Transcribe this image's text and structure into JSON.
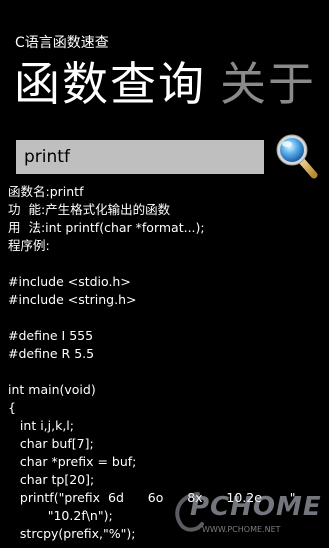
{
  "app": {
    "title": "C语言函数速查"
  },
  "pivot": {
    "items": [
      {
        "label": "函数查询"
      },
      {
        "label": "关于"
      }
    ]
  },
  "search": {
    "value": "printf",
    "button_icon": "magnifier-icon"
  },
  "result": {
    "lines": [
      "函数名:printf",
      "功  能:产生格式化输出的函数",
      "用  法:int printf(char *format...);",
      "程序例:",
      "",
      "#include <stdio.h>",
      "#include <string.h>",
      "",
      "#define I 555",
      "#define R 5.5",
      "",
      "int main(void)",
      "{",
      "   int i,j,k,l;",
      "   char buf[7];",
      "   char *prefix = buf;",
      "   char tp[20];",
      "   printf(\"prefix  6d      6o      8x      10.2e       \"",
      "          \"10.2f\\n\");",
      "   strcpy(prefix,\"%\");"
    ]
  },
  "watermark": {
    "logo": "PCHOME",
    "url": "WWW.PCHOME.NET"
  }
}
